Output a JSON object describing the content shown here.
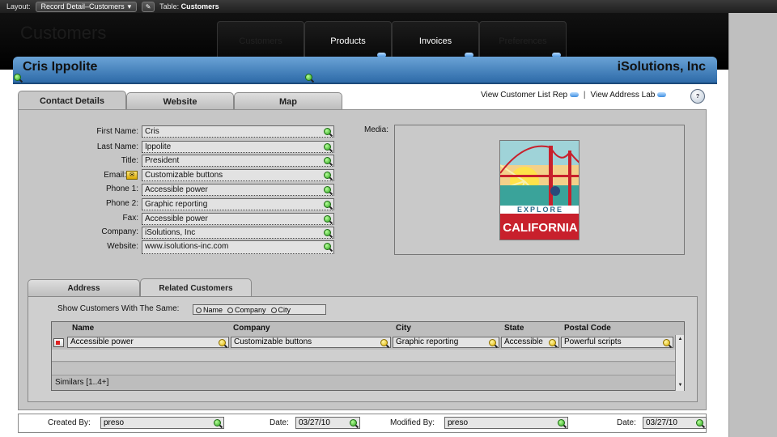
{
  "toolbar": {
    "layout_label": "Layout:",
    "layout_value": "Record Detail–Customers",
    "table_label": "Table:",
    "table_value": "Customers"
  },
  "header": {
    "title": "Customers",
    "nav_tabs": [
      "Customers",
      "Products",
      "Invoices",
      "Preferences"
    ]
  },
  "record": {
    "name": "Cris Ippolite",
    "company_banner": "iSolutions, Inc"
  },
  "tabs": [
    "Contact Details",
    "Website",
    "Map"
  ],
  "links": {
    "customer_list": "View Customer List Rep",
    "separator": "|",
    "address_labels": "View Address Lab"
  },
  "fields": [
    {
      "label": "First Name:",
      "value": "Cris"
    },
    {
      "label": "Last Name:",
      "value": "Ippolite"
    },
    {
      "label": "Title:",
      "value": "President"
    },
    {
      "label": "Email:",
      "value": "Customizable buttons"
    },
    {
      "label": "Phone 1:",
      "value": "Accessible power"
    },
    {
      "label": "Phone 2:",
      "value": "Graphic reporting"
    },
    {
      "label": "Fax:",
      "value": "Accessible power"
    },
    {
      "label": "Company:",
      "value": "iSolutions, Inc"
    },
    {
      "label": "Website:",
      "value": "www.isolutions-inc.com"
    }
  ],
  "media": {
    "label": "Media:",
    "poster_top": "EXPLORE",
    "poster_bottom": "CALIFORNIA"
  },
  "lower_tabs": [
    "Address",
    "Related Customers"
  ],
  "related": {
    "show_label": "Show Customers With The Same:",
    "options": [
      "Name",
      "Company",
      "City"
    ],
    "columns": [
      "Name",
      "Company",
      "City",
      "State",
      "Postal Code"
    ],
    "row": [
      "Accessible power",
      "Customizable buttons",
      "Graphic reporting",
      "Accessible power",
      "Powerful scripts"
    ],
    "similars": "Similars [1..4+]"
  },
  "footer": {
    "created_by_label": "Created By:",
    "created_by": "preso",
    "date1_label": "Date:",
    "date1": "03/27/10",
    "modified_by_label": "Modified By:",
    "modified_by": "preso",
    "date2_label": "Date:",
    "date2": "03/27/10"
  },
  "colors": {
    "band_blue": "#2d6aa8",
    "panel_gray": "#c6c6c6",
    "poster_red": "#c8202c"
  }
}
